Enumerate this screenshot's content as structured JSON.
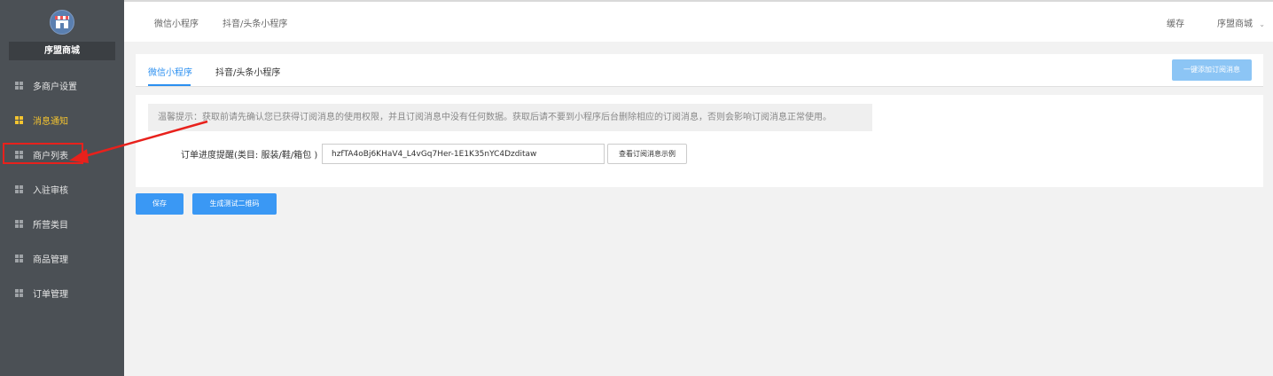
{
  "sidebar": {
    "store_name": "序盟商城",
    "items": [
      {
        "label": "多商户设置",
        "active": false
      },
      {
        "label": "消息通知",
        "active": true
      },
      {
        "label": "商户列表",
        "active": false
      },
      {
        "label": "入驻审核",
        "active": false
      },
      {
        "label": "所营类目",
        "active": false
      },
      {
        "label": "商品管理",
        "active": false
      },
      {
        "label": "订单管理",
        "active": false
      }
    ]
  },
  "topbar": {
    "tabs": [
      "微信小程序",
      "抖音/头条小程序"
    ],
    "cache_label": "缓存",
    "store_menu": "序盟商城"
  },
  "content": {
    "tabs": [
      "微信小程序",
      "抖音/头条小程序"
    ],
    "add_subscription_button": "一键添加订阅消息",
    "tip": "温馨提示：获取前请先确认您已获得订阅消息的使用权限，并且订阅消息中没有任何数据。获取后请不要到小程序后台删除相应的订阅消息，否则会影响订阅消息正常使用。",
    "field_label": "订单进度提醒(类目: 服装/鞋/箱包 )",
    "field_value": "hzfTA4oBj6KHaV4_L4vGq7Her-1E1K35nYC4Dzditaw",
    "view_example_button": "查看订阅消息示例",
    "save_button": "保存",
    "qrcode_button": "生成测试二维码"
  },
  "colors": {
    "sidebar_bg": "#4b5055",
    "active_menu": "#f4c42f",
    "accent_blue": "#2b8ff0",
    "annotation_red": "#e8211c"
  }
}
